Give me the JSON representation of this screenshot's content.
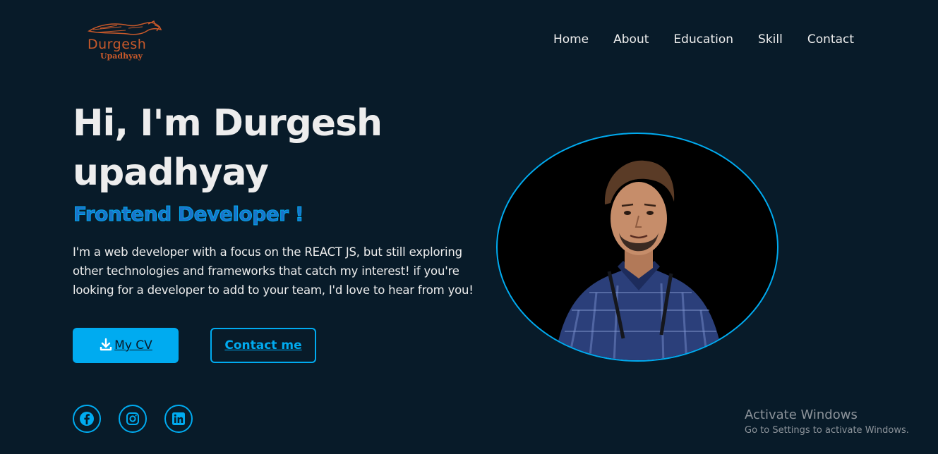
{
  "logo": {
    "name": "Durgesh",
    "sub": "Upadhyay"
  },
  "nav": {
    "items": [
      "Home",
      "About",
      "Education",
      "Skill",
      "Contact"
    ]
  },
  "hero": {
    "title_line1": "Hi, I'm Durgesh",
    "title_line2": "upadhyay",
    "role": "Frontend Developer !",
    "description": "I'm a web developer with a focus on the REACT JS, but still exploring other technologies and frameworks that catch my interest! if you're looking for a developer to add to your team, I'd love to hear from you!"
  },
  "buttons": {
    "cv_label": "My CV",
    "contact_label": "Contact me"
  },
  "social": {
    "icons": [
      "facebook-icon",
      "instagram-icon",
      "linkedin-icon"
    ]
  },
  "watermark": {
    "title": "Activate Windows",
    "subtitle": "Go to Settings to activate Windows."
  },
  "colors": {
    "background": "#081b29",
    "accent": "#00abf0",
    "text": "#ededed",
    "logo": "#c8592a"
  }
}
